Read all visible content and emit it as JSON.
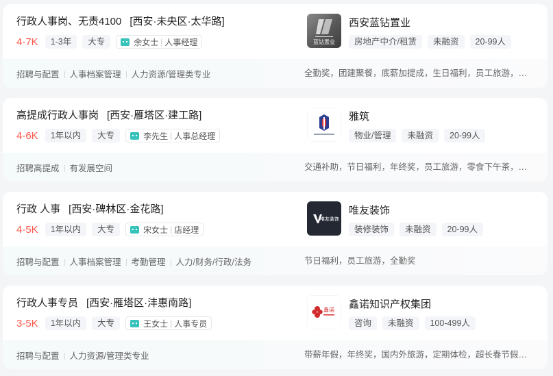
{
  "jobs": [
    {
      "title": "行政人事岗、无责4100",
      "area": "[西安·未央区·太华路]",
      "salary": "4-7K",
      "experience": "1-3年",
      "education": "大专",
      "boss_name": "余女士",
      "boss_title": "人事经理",
      "company": "西安蓝钻置业",
      "company_logo_icon": "lanzuan-logo-icon",
      "company_industry": "房地产中介/租赁",
      "company_stage": "未融资",
      "company_size": "20-99人",
      "skills": [
        "招聘与配置",
        "人事档案管理",
        "人力资源/管理类专业"
      ],
      "welfare": "全勤奖，团建聚餐，底薪加提成，生日福利，员工旅游，零食下午茶"
    },
    {
      "title": "高提成行政人事岗",
      "area": "[西安·雁塔区·建工路]",
      "salary": "4-6K",
      "experience": "1年以内",
      "education": "大专",
      "boss_name": "李先生",
      "boss_title": "人事总经理",
      "company": "雅筑",
      "company_logo_icon": "yazhu-logo-icon",
      "company_industry": "物业/管理",
      "company_stage": "未融资",
      "company_size": "20-99人",
      "skills": [
        "招聘高提成",
        "有发展空间"
      ],
      "welfare": "交通补助，节日福利，年终奖，员工旅游，零食下午茶，带薪年假"
    },
    {
      "title": "行政 人事",
      "area": "[西安·碑林区·金花路]",
      "salary": "4-5K",
      "experience": "1年以内",
      "education": "大专",
      "boss_name": "宋女士",
      "boss_title": "店经理",
      "company": "唯友装饰",
      "company_logo_icon": "weiyou-logo-icon",
      "company_industry": "装修装饰",
      "company_stage": "未融资",
      "company_size": "20-99人",
      "skills": [
        "招聘与配置",
        "人事档案管理",
        "考勤管理",
        "人力/财务/行政/法务"
      ],
      "welfare": "节日福利，员工旅游，全勤奖"
    },
    {
      "title": "行政人事专员",
      "area": "[西安·雁塔区·沣惠南路]",
      "salary": "3-5K",
      "experience": "1年以内",
      "education": "大专",
      "boss_name": "王女士",
      "boss_title": "人事专员",
      "company": "鑫诺知识产权集团",
      "company_logo_icon": "xinnuo-logo-icon",
      "company_industry": "咨询",
      "company_stage": "未融资",
      "company_size": "100-499人",
      "skills": [
        "招聘与配置",
        "人力资源/管理类专业"
      ],
      "welfare": "带薪年假，年终奖，国内外旅游，定期体检，超长春节假，员工旅游"
    }
  ],
  "logos": {
    "lanzuan_text": "蓝钻置业",
    "weiyou_text": "唯友装饰",
    "xinnuo_text": "鑫诺"
  },
  "colors": {
    "salary": "#fe574a",
    "chat_icon": "#37c2bc",
    "page_bg": "#f4f5f7"
  }
}
